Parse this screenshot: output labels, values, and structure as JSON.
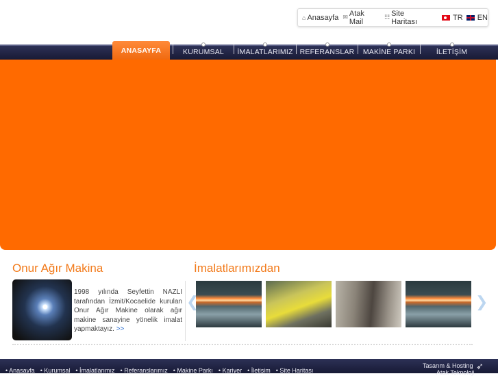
{
  "top_links": {
    "home": "Anasayfa",
    "mail": "Atak Mail",
    "sitemap": "Site Haritası"
  },
  "languages": [
    "TR",
    "EN"
  ],
  "nav": {
    "items": [
      "ANASAYFA",
      "KURUMSAL",
      "İMALATLARIMIZ",
      "REFERANSLAR",
      "MAKİNE PARKI",
      "İLETİŞİM"
    ]
  },
  "about": {
    "title": "Onur Ağır Makina",
    "text": "1998 yılında Seyfettin NAZLI tarafından İzmit/Kocaelide kurulan Onur Ağır Makine olarak ağır makine sanayine yönelik imalat yapmaktayız.",
    "more": ">>"
  },
  "products": {
    "title": "İmalatlarımızdan",
    "prev": "❮",
    "next": "❯"
  },
  "footer": {
    "items": [
      "Anasayfa",
      "Kurumsal",
      "İmalatlarımız",
      "Referanslarımız",
      "Makine Parkı",
      "Kariyer",
      "İletişim",
      "Site Haritası"
    ],
    "credit_line1": "Tasarım & Hosting",
    "credit_line2": "Atak Teknoloji"
  },
  "colors": {
    "accent": "#ff6a00",
    "title_orange": "#f27a1a",
    "nav_dark": "#1f2241",
    "link_blue": "#2c6fd1"
  },
  "icons": [
    "home-icon",
    "mail-icon",
    "sitemap-icon",
    "flag-tr-icon",
    "flag-en-icon",
    "arrow-left-icon",
    "arrow-right-icon",
    "atak-logo-icon"
  ]
}
